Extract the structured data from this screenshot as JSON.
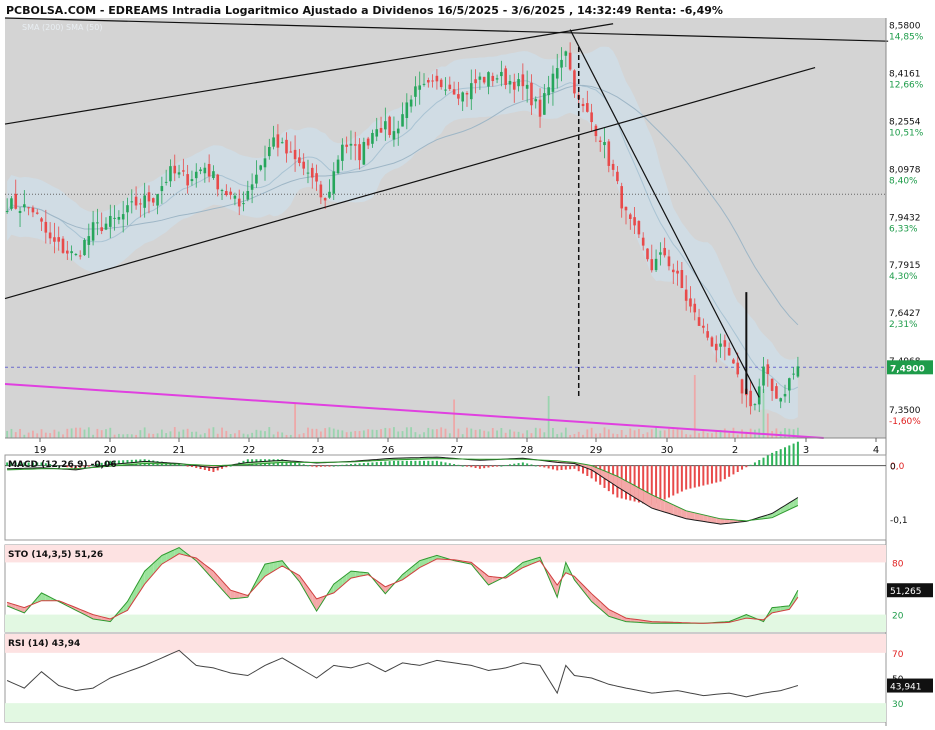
{
  "header": {
    "title": "PCBOLSA.COM - EDREAMS Intradia Logaritmico Ajustado a Dividenos 16/5/2025 - 3/6/2025 , 14:32:49 Renta: -6,49%",
    "legend_text": "SMA (200) SMA (50)"
  },
  "colors": {
    "up": "#26a65b",
    "down": "#e84a4a",
    "band": "#cfdde6",
    "main_bg": "#d4d4d4",
    "trend_magenta": "#e040e0",
    "percent_label": "#1e9c4a",
    "percent_negative": "#e02020",
    "price_tag": "#1e9c4a"
  },
  "chart_data": [
    {
      "type": "candlestick",
      "title": "EDREAMS Intradia Logaritmico",
      "y_scale": "log",
      "ylim": [
        7.28,
        8.62
      ],
      "price_ticks": [
        {
          "price": 8.58,
          "label": "8,5800",
          "pct": "14,85%"
        },
        {
          "price": 8.4161,
          "label": "8,4161",
          "pct": "12,66%"
        },
        {
          "price": 8.2554,
          "label": "8,2554",
          "pct": "10,51%"
        },
        {
          "price": 8.0978,
          "label": "8,0978",
          "pct": "8,40%"
        },
        {
          "price": 7.9432,
          "label": "7,9432",
          "pct": "6,33%"
        },
        {
          "price": 7.7915,
          "label": "7,7915",
          "pct": "4,30%"
        },
        {
          "price": 7.6427,
          "label": "7,6427",
          "pct": "2,31%"
        },
        {
          "price": 7.4968,
          "label": "7,4968",
          "pct": ""
        },
        {
          "price": 7.35,
          "label": "7,3500",
          "pct": "-1,60%"
        }
      ],
      "last_price": {
        "price": 7.49,
        "label": "7,4900"
      },
      "reference_level": 8.03,
      "x_labels": [
        "19",
        "20",
        "21",
        "22",
        "23",
        "26",
        "27",
        "28",
        "29",
        "30",
        "2",
        "3",
        "4"
      ],
      "close_path": [
        [
          0,
          8.0
        ],
        [
          6,
          7.98
        ],
        [
          10,
          7.88
        ],
        [
          16,
          7.83
        ],
        [
          20,
          7.92
        ],
        [
          26,
          7.95
        ],
        [
          30,
          8.0
        ],
        [
          34,
          8.02
        ],
        [
          38,
          8.1
        ],
        [
          42,
          8.08
        ],
        [
          46,
          8.12
        ],
        [
          50,
          8.05
        ],
        [
          54,
          7.99
        ],
        [
          58,
          8.1
        ],
        [
          62,
          8.21
        ],
        [
          66,
          8.15
        ],
        [
          70,
          8.1
        ],
        [
          74,
          8.0
        ],
        [
          78,
          8.2
        ],
        [
          82,
          8.16
        ],
        [
          86,
          8.26
        ],
        [
          90,
          8.23
        ],
        [
          94,
          8.36
        ],
        [
          98,
          8.38
        ],
        [
          102,
          8.4
        ],
        [
          106,
          8.36
        ],
        [
          110,
          8.41
        ],
        [
          114,
          8.42
        ],
        [
          118,
          8.4
        ],
        [
          121,
          8.37
        ],
        [
          124,
          8.3
        ],
        [
          126,
          8.38
        ],
        [
          128,
          8.46
        ],
        [
          130,
          8.52
        ],
        [
          131,
          8.44
        ],
        [
          133,
          8.33
        ],
        [
          135,
          8.29
        ],
        [
          138,
          8.22
        ],
        [
          141,
          8.1
        ],
        [
          144,
          7.96
        ],
        [
          147,
          7.88
        ],
        [
          150,
          7.8
        ],
        [
          153,
          7.84
        ],
        [
          156,
          7.76
        ],
        [
          159,
          7.67
        ],
        [
          162,
          7.6
        ],
        [
          165,
          7.55
        ],
        [
          168,
          7.52
        ],
        [
          170,
          7.45
        ],
        [
          172,
          7.4
        ],
        [
          174,
          7.38
        ],
        [
          176,
          7.48
        ],
        [
          178,
          7.42
        ],
        [
          180,
          7.4
        ],
        [
          182,
          7.45
        ],
        [
          184,
          7.49
        ]
      ],
      "volume_spikes": [
        [
          67,
          0.5
        ],
        [
          104,
          0.55
        ],
        [
          126,
          0.6
        ],
        [
          160,
          0.9
        ],
        [
          176,
          0.7
        ],
        [
          177,
          0.35
        ]
      ],
      "trendlines": [
        {
          "from": [
            0,
            8.26
          ],
          "to": [
            141,
            8.6
          ],
          "color": "black"
        },
        {
          "from": [
            0,
            7.7
          ],
          "to": [
            188,
            8.45
          ],
          "color": "black"
        },
        {
          "from": [
            0,
            8.62
          ],
          "to": [
            205,
            8.54
          ],
          "color": "black"
        },
        {
          "from": [
            131,
            8.58
          ],
          "to": [
            175,
            7.4
          ],
          "color": "black"
        },
        {
          "from": [
            0,
            7.44
          ],
          "to": [
            190,
            7.28
          ],
          "color": "magenta"
        }
      ],
      "vertical_markers": [
        {
          "x": 133,
          "from": 7.4,
          "to": 8.52,
          "style": "dashed"
        },
        {
          "x": 172,
          "from": 7.41,
          "to": 7.72,
          "style": "solid"
        }
      ]
    },
    {
      "type": "macd",
      "title": "MACD (12,26,9)",
      "value": "-0,06",
      "ylim": [
        -0.14,
        0.02
      ],
      "ticks": [
        {
          "value": 0.0,
          "label": "0,0",
          "color": "#e02020"
        },
        {
          "value": 0.0,
          "label": "0",
          "color": "#111111"
        },
        {
          "value": -0.1,
          "label": "-0,1",
          "color": "#111111"
        }
      ],
      "macd_path": [
        [
          0,
          -0.006
        ],
        [
          8,
          -0.004
        ],
        [
          16,
          -0.008
        ],
        [
          24,
          0.002
        ],
        [
          32,
          0.008
        ],
        [
          40,
          0.004
        ],
        [
          48,
          -0.004
        ],
        [
          56,
          0.006
        ],
        [
          64,
          0.01
        ],
        [
          72,
          0.005
        ],
        [
          80,
          0.008
        ],
        [
          90,
          0.014
        ],
        [
          100,
          0.016
        ],
        [
          110,
          0.01
        ],
        [
          120,
          0.014
        ],
        [
          128,
          0.006
        ],
        [
          132,
          0.004
        ],
        [
          136,
          -0.008
        ],
        [
          142,
          -0.04
        ],
        [
          150,
          -0.08
        ],
        [
          158,
          -0.1
        ],
        [
          166,
          -0.11
        ],
        [
          172,
          -0.105
        ],
        [
          178,
          -0.09
        ],
        [
          184,
          -0.06
        ]
      ],
      "signal_path": [
        [
          0,
          -0.008
        ],
        [
          8,
          -0.006
        ],
        [
          16,
          -0.006
        ],
        [
          24,
          -0.001
        ],
        [
          32,
          0.004
        ],
        [
          40,
          0.003
        ],
        [
          48,
          0.0
        ],
        [
          56,
          0.002
        ],
        [
          64,
          0.006
        ],
        [
          72,
          0.006
        ],
        [
          80,
          0.007
        ],
        [
          90,
          0.011
        ],
        [
          100,
          0.013
        ],
        [
          110,
          0.012
        ],
        [
          120,
          0.012
        ],
        [
          128,
          0.009
        ],
        [
          132,
          0.006
        ],
        [
          136,
          0.0
        ],
        [
          142,
          -0.02
        ],
        [
          150,
          -0.055
        ],
        [
          158,
          -0.085
        ],
        [
          166,
          -0.1
        ],
        [
          172,
          -0.104
        ],
        [
          178,
          -0.098
        ],
        [
          184,
          -0.075
        ]
      ]
    },
    {
      "type": "stochastic",
      "title": "STO (14,3,5)",
      "value": "51,26",
      "last_label": "51,265",
      "ylim": [
        0,
        100
      ],
      "levels": [
        {
          "value": 80,
          "label": "80",
          "color": "#e02020"
        },
        {
          "value": 20,
          "label": "20",
          "color": "#1e9c4a"
        }
      ],
      "k_path": [
        [
          0,
          30
        ],
        [
          4,
          22
        ],
        [
          8,
          45
        ],
        [
          12,
          35
        ],
        [
          16,
          25
        ],
        [
          20,
          15
        ],
        [
          24,
          12
        ],
        [
          28,
          35
        ],
        [
          32,
          70
        ],
        [
          36,
          88
        ],
        [
          40,
          97
        ],
        [
          44,
          82
        ],
        [
          48,
          60
        ],
        [
          52,
          38
        ],
        [
          56,
          40
        ],
        [
          60,
          78
        ],
        [
          64,
          82
        ],
        [
          68,
          58
        ],
        [
          72,
          24
        ],
        [
          76,
          55
        ],
        [
          80,
          70
        ],
        [
          84,
          68
        ],
        [
          88,
          44
        ],
        [
          92,
          66
        ],
        [
          96,
          82
        ],
        [
          100,
          88
        ],
        [
          104,
          82
        ],
        [
          108,
          78
        ],
        [
          112,
          54
        ],
        [
          116,
          64
        ],
        [
          120,
          80
        ],
        [
          124,
          86
        ],
        [
          128,
          40
        ],
        [
          130,
          80
        ],
        [
          132,
          60
        ],
        [
          136,
          35
        ],
        [
          140,
          18
        ],
        [
          144,
          12
        ],
        [
          150,
          10
        ],
        [
          156,
          10
        ],
        [
          162,
          10
        ],
        [
          168,
          12
        ],
        [
          172,
          20
        ],
        [
          176,
          12
        ],
        [
          178,
          28
        ],
        [
          182,
          30
        ],
        [
          184,
          48
        ]
      ],
      "d_path": [
        [
          0,
          34
        ],
        [
          4,
          28
        ],
        [
          8,
          36
        ],
        [
          12,
          36
        ],
        [
          16,
          28
        ],
        [
          20,
          20
        ],
        [
          24,
          15
        ],
        [
          28,
          25
        ],
        [
          32,
          55
        ],
        [
          36,
          78
        ],
        [
          40,
          90
        ],
        [
          44,
          85
        ],
        [
          48,
          70
        ],
        [
          52,
          48
        ],
        [
          56,
          42
        ],
        [
          60,
          64
        ],
        [
          64,
          76
        ],
        [
          68,
          65
        ],
        [
          72,
          38
        ],
        [
          76,
          45
        ],
        [
          80,
          62
        ],
        [
          84,
          66
        ],
        [
          88,
          52
        ],
        [
          92,
          60
        ],
        [
          96,
          74
        ],
        [
          100,
          84
        ],
        [
          104,
          83
        ],
        [
          108,
          80
        ],
        [
          112,
          64
        ],
        [
          116,
          62
        ],
        [
          120,
          74
        ],
        [
          124,
          82
        ],
        [
          128,
          54
        ],
        [
          130,
          68
        ],
        [
          132,
          64
        ],
        [
          136,
          44
        ],
        [
          140,
          26
        ],
        [
          144,
          16
        ],
        [
          150,
          12
        ],
        [
          156,
          11
        ],
        [
          162,
          10
        ],
        [
          168,
          11
        ],
        [
          172,
          16
        ],
        [
          176,
          14
        ],
        [
          178,
          22
        ],
        [
          182,
          26
        ],
        [
          184,
          40
        ]
      ]
    },
    {
      "type": "rsi",
      "title": "RSI (14)",
      "value": "43,94",
      "last_label": "43,941",
      "ylim": [
        15,
        85
      ],
      "levels": [
        {
          "value": 70,
          "label": "70",
          "color": "#e02020"
        },
        {
          "value": 50,
          "label": "50",
          "color": "#111111"
        },
        {
          "value": 30,
          "label": "30",
          "color": "#1e9c4a"
        }
      ],
      "path": [
        [
          0,
          48
        ],
        [
          4,
          42
        ],
        [
          8,
          55
        ],
        [
          12,
          44
        ],
        [
          16,
          40
        ],
        [
          20,
          42
        ],
        [
          24,
          50
        ],
        [
          28,
          55
        ],
        [
          32,
          60
        ],
        [
          36,
          66
        ],
        [
          40,
          72
        ],
        [
          44,
          60
        ],
        [
          48,
          58
        ],
        [
          52,
          54
        ],
        [
          56,
          52
        ],
        [
          60,
          60
        ],
        [
          64,
          66
        ],
        [
          68,
          58
        ],
        [
          72,
          50
        ],
        [
          76,
          60
        ],
        [
          80,
          58
        ],
        [
          84,
          62
        ],
        [
          88,
          55
        ],
        [
          92,
          62
        ],
        [
          96,
          60
        ],
        [
          100,
          64
        ],
        [
          104,
          62
        ],
        [
          108,
          60
        ],
        [
          112,
          56
        ],
        [
          116,
          58
        ],
        [
          120,
          62
        ],
        [
          124,
          60
        ],
        [
          128,
          38
        ],
        [
          130,
          60
        ],
        [
          132,
          52
        ],
        [
          136,
          50
        ],
        [
          140,
          45
        ],
        [
          144,
          42
        ],
        [
          150,
          38
        ],
        [
          156,
          40
        ],
        [
          162,
          36
        ],
        [
          168,
          38
        ],
        [
          172,
          35
        ],
        [
          176,
          38
        ],
        [
          180,
          40
        ],
        [
          184,
          44
        ]
      ]
    }
  ]
}
